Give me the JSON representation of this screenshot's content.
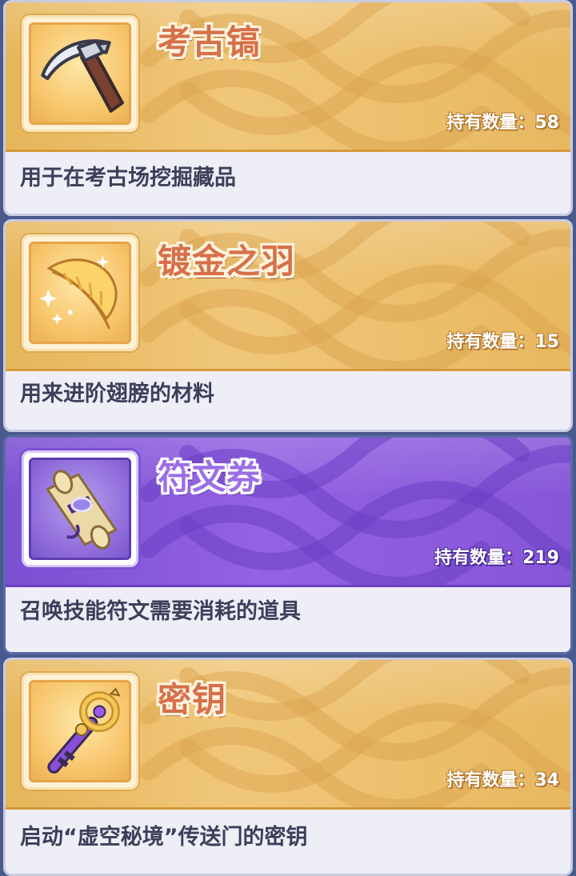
{
  "items": [
    {
      "name": "考古镐",
      "icon": "pickaxe-icon",
      "quantity_label": "持有数量：",
      "quantity": "58",
      "description": "用于在考古场挖掘藏品",
      "theme": "gold"
    },
    {
      "name": "镀金之羽",
      "icon": "golden-feather-icon",
      "quantity_label": "持有数量：",
      "quantity": "15",
      "description": "用来进阶翅膀的材料",
      "theme": "gold"
    },
    {
      "name": "符文券",
      "icon": "scroll-icon",
      "quantity_label": "持有数量：",
      "quantity": "219",
      "description": "召唤技能符文需要消耗的道具",
      "theme": "purple"
    },
    {
      "name": "密钥",
      "icon": "key-icon",
      "quantity_label": "持有数量：",
      "quantity": "34",
      "description": "启动“虚空秘境”传送门的密钥",
      "theme": "gold"
    }
  ],
  "colors": {
    "gold_header": "#eab860",
    "purple_header": "#8a5ad8",
    "card_body": "#eeeef7",
    "page_background": "#4a5a8c"
  }
}
